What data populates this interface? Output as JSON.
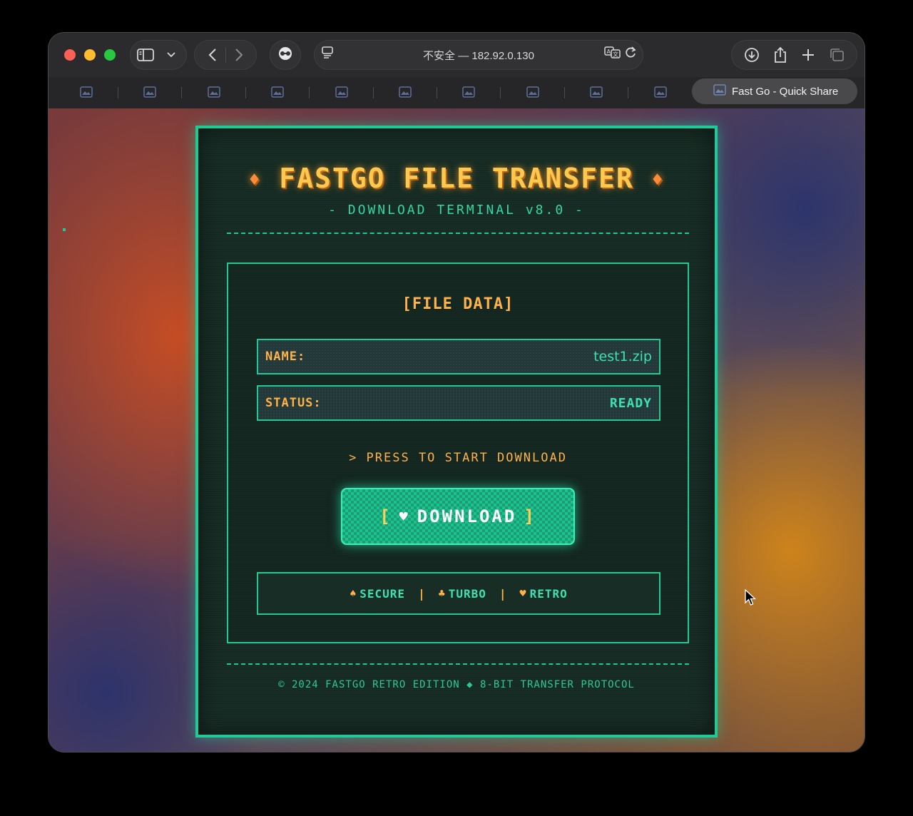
{
  "browser": {
    "url": "不安全 — 182.92.0.130",
    "active_tab_title": "Fast Go - Quick Share",
    "inactive_tab_count": 10
  },
  "page": {
    "title": "FASTGO FILE TRANSFER",
    "title_ornament": "♦",
    "subtitle": "- DOWNLOAD TERMINAL v8.0 -",
    "panel_title": "[FILE DATA]",
    "file": {
      "name_label": "NAME:",
      "name_value": "test1.zip",
      "status_label": "STATUS:",
      "status_value": "READY"
    },
    "prompt": "> PRESS TO START DOWNLOAD",
    "download_button": {
      "bracket_left": "[",
      "symbol": "♥",
      "label": "DOWNLOAD",
      "bracket_right": "]"
    },
    "badges": [
      {
        "symbol": "♠",
        "label": "SECURE"
      },
      {
        "symbol": "♣",
        "label": "TURBO"
      },
      {
        "symbol": "♥",
        "label": "RETRO"
      }
    ],
    "badge_separator": "|",
    "footer": "© 2024 FASTGO RETRO EDITION ◆ 8-BIT TRANSFER PROTOCOL"
  },
  "colors": {
    "accent_green": "#21c997",
    "accent_orange": "#ffb24a",
    "title_gold": "#ffc94f"
  }
}
